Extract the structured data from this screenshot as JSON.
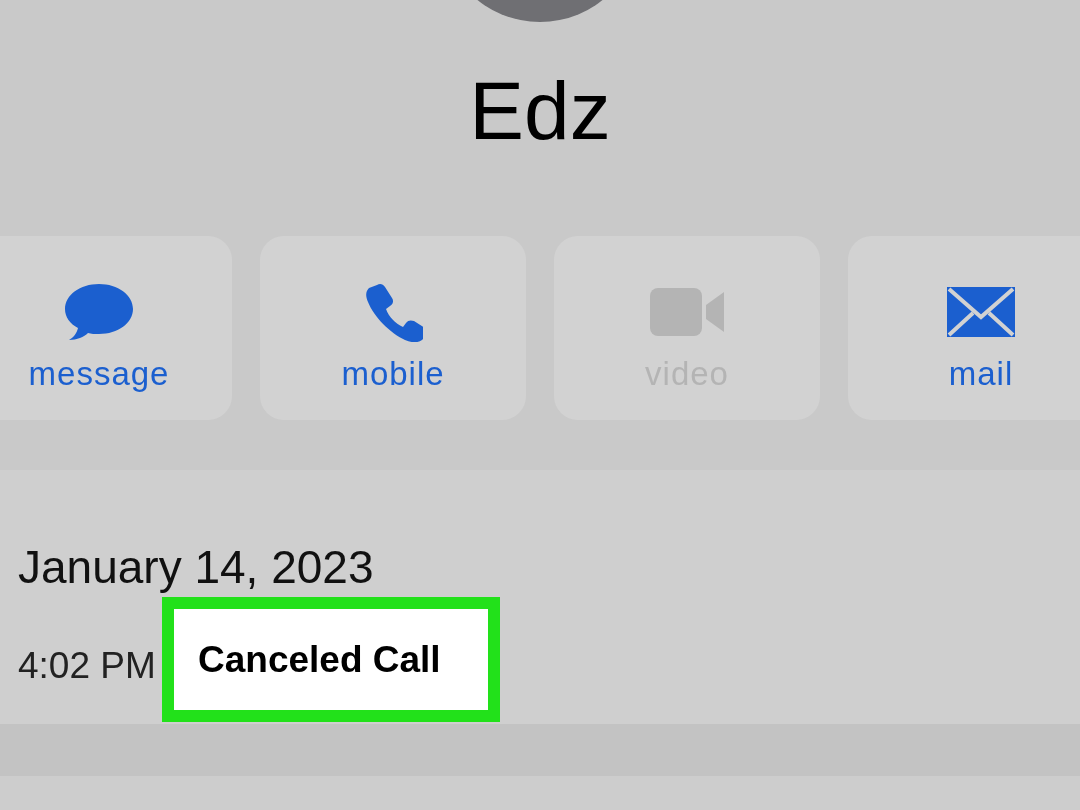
{
  "contact": {
    "name": "Edz"
  },
  "actions": [
    {
      "kind": "message",
      "label": "message",
      "disabled": false
    },
    {
      "kind": "phone",
      "label": "mobile",
      "disabled": false
    },
    {
      "kind": "video",
      "label": "video",
      "disabled": true
    },
    {
      "kind": "mail",
      "label": "mail",
      "disabled": false
    }
  ],
  "call_log": {
    "date": "January 14, 2023",
    "time": "4:02 PM",
    "status": "Canceled Call",
    "highlighted": true
  }
}
